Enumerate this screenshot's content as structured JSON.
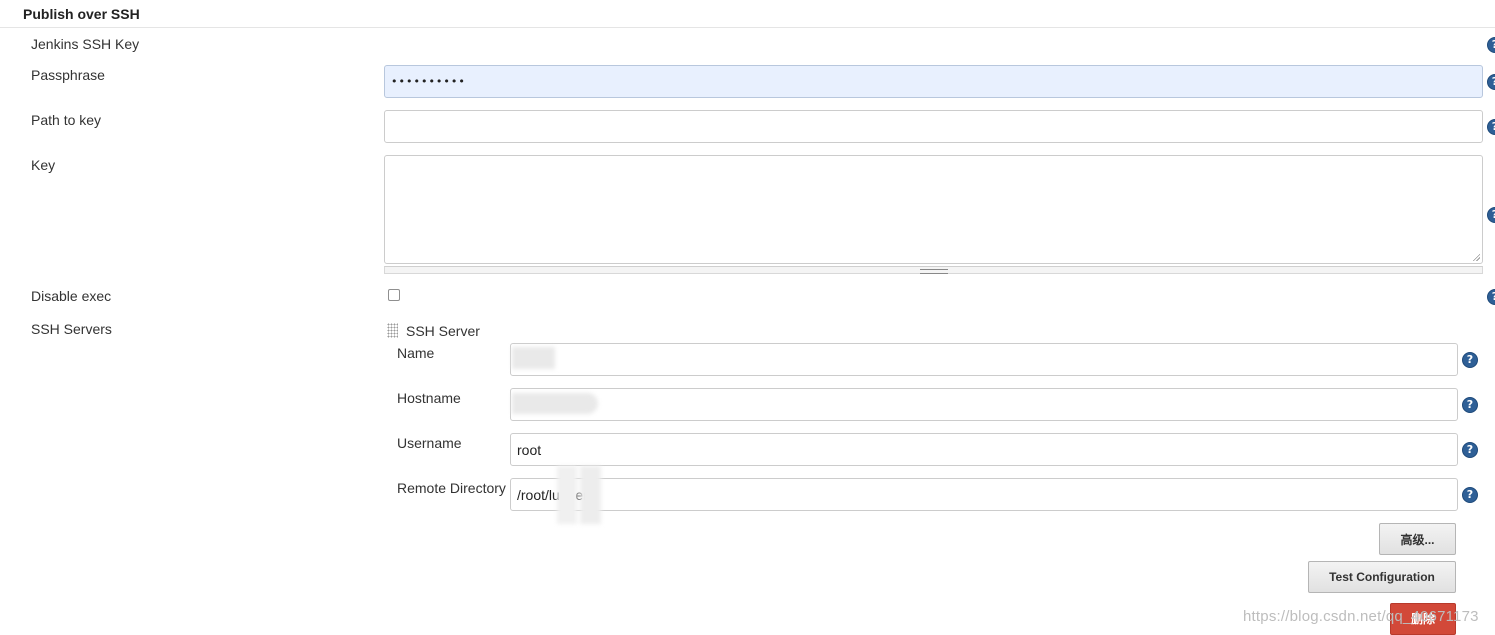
{
  "section": {
    "title": "Publish over SSH"
  },
  "fields": {
    "jenkins_ssh_key": {
      "label": "Jenkins SSH Key"
    },
    "passphrase": {
      "label": "Passphrase",
      "value": "••••••••••"
    },
    "path_to_key": {
      "label": "Path to key",
      "value": ""
    },
    "key": {
      "label": "Key",
      "value": ""
    },
    "disable_exec": {
      "label": "Disable exec"
    },
    "ssh_servers": {
      "label": "SSH Servers"
    }
  },
  "ssh_server": {
    "title": "SSH Server",
    "name": {
      "label": "Name",
      "value": ""
    },
    "hostname": {
      "label": "Hostname",
      "value": ""
    },
    "username": {
      "label": "Username",
      "value": "root"
    },
    "remote_directory": {
      "label": "Remote Directory",
      "value": "/root/lu    er"
    }
  },
  "buttons": {
    "advanced": "高级...",
    "test_configuration": "Test Configuration",
    "delete": "删除"
  },
  "help_icon_glyph": "?",
  "watermark": "https://blog.csdn.net/qq_40671173"
}
